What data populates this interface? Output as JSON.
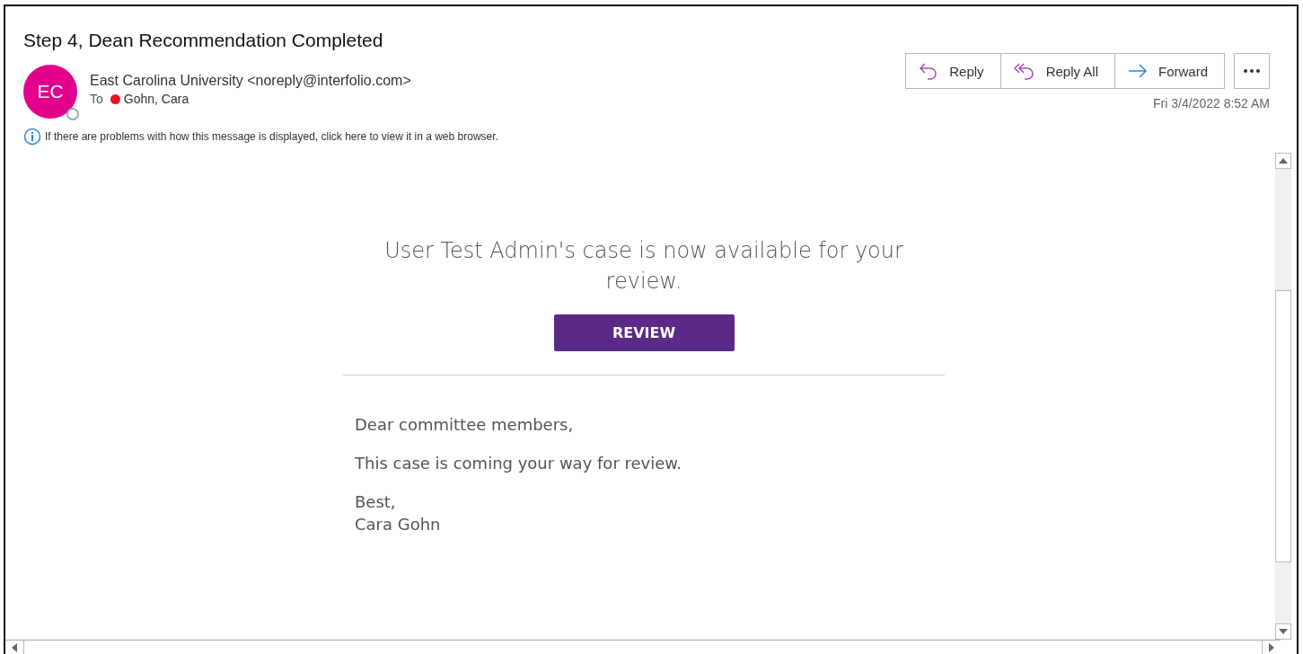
{
  "subject": "Step 4, Dean Recommendation Completed",
  "sender": {
    "initials": "EC",
    "name": "East Carolina University <noreply@interfolio.com>"
  },
  "recipient": {
    "label": "To",
    "name": "Gohn, Cara"
  },
  "info_bar": "If there are problems with how this message is displayed, click here to view it in a web browser.",
  "actions": [
    {
      "kind": "reply",
      "label": "Reply"
    },
    {
      "kind": "reply_all",
      "label": "Reply All"
    },
    {
      "kind": "forward",
      "label": "Forward"
    }
  ],
  "date": "Fri 3/4/2022 8:52 AM",
  "body": {
    "headline": "User Test Admin's case is now available for your review.",
    "button": "REVIEW",
    "paragraphs": [
      [
        "Dear committee members,"
      ],
      [
        "This case is coming your way for review."
      ],
      [
        "Best,",
        "Cara Gohn"
      ]
    ]
  }
}
